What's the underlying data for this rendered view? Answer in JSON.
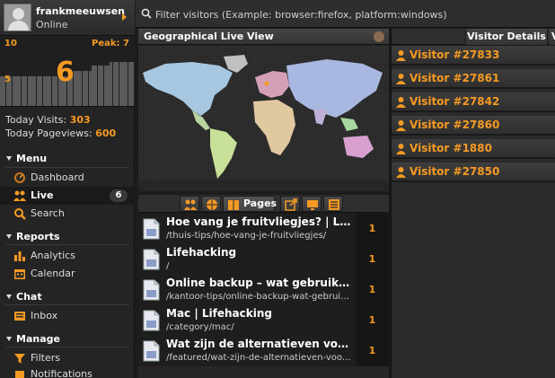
{
  "user": {
    "name": "frankmeeuwsen",
    "status": "Online"
  },
  "graph": {
    "top_left": "10",
    "peak": "Peak: 7",
    "mid_left": "5",
    "current": "6"
  },
  "stats": {
    "today_visits_label": "Today Visits:",
    "today_visits_value": "303",
    "today_pageviews_label": "Today Pageviews:",
    "today_pageviews_value": "600"
  },
  "nav": {
    "menu_title": "Menu",
    "dashboard": "Dashboard",
    "live": "Live",
    "live_badge": "6",
    "search": "Search",
    "reports_title": "Reports",
    "analytics": "Analytics",
    "calendar": "Calendar",
    "chat_title": "Chat",
    "inbox": "Inbox",
    "manage_title": "Manage",
    "filters": "Filters",
    "notifications": "Notifications"
  },
  "search": {
    "placeholder": "Filter visitors (Example: browser:firefox, platform:windows)"
  },
  "map": {
    "title": "Geographical Live View"
  },
  "pages_tab": {
    "label": "Pages"
  },
  "pages": [
    {
      "title": "Hoe vang je fruitvliegjes? | Life...",
      "url": "/thuis-tips/hoe-vang-je-fruitvliegjes/",
      "count": "1"
    },
    {
      "title": "Lifehacking",
      "url": "/",
      "count": "1"
    },
    {
      "title": "Online backup – wat gebruik je...",
      "url": "/kantoor-tips/online-backup-wat-gebruik...",
      "count": "1"
    },
    {
      "title": "Mac | Lifehacking",
      "url": "/category/mac/",
      "count": "1"
    },
    {
      "title": "Wat zijn de alternatieven voor ...",
      "url": "/featured/wat-zijn-de-alternatieven-voo...",
      "count": "1"
    }
  ],
  "visitor_panel": {
    "tab_label": "Visitor Details",
    "tab2_label": "V"
  },
  "visitors": [
    "Visitor #27833",
    "Visitor #27861",
    "Visitor #27842",
    "Visitor #27860",
    "Visitor #1880",
    "Visitor #27850"
  ],
  "colors": {
    "accent": "#f59a23",
    "background": "#1c1c1c"
  }
}
